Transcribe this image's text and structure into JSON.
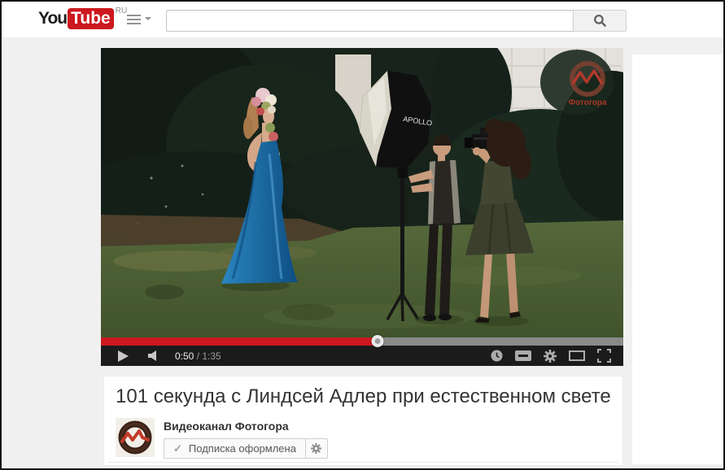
{
  "header": {
    "logo_you": "You",
    "logo_tube": "Tube",
    "logo_region": "RU",
    "search_value": ""
  },
  "player": {
    "current_time": "0:50",
    "time_separator": " / ",
    "duration": "1:35",
    "progress_percent": 53,
    "watermark": "Фотогора",
    "softbox_label": "APOLLO"
  },
  "info": {
    "title": "101 секунда с Линдсей Адлер при естественном свете",
    "channel": "Видеоканал Фотогора",
    "subscribed_label": "Подписка оформлена",
    "check_glyph": "✓"
  },
  "colors": {
    "brand_red": "#cc181e",
    "controls_bg": "#1b1b1b",
    "page_bg": "#f0f0f0",
    "title_color": "#333333"
  },
  "icons": [
    "guide-icon",
    "search-icon",
    "play-icon",
    "volume-icon",
    "watch-later-icon",
    "captions-icon",
    "settings-icon",
    "theater-mode-icon",
    "fullscreen-icon",
    "subscribe-check-icon",
    "subscription-settings-icon",
    "channel-avatar",
    "photogora-watermark"
  ]
}
